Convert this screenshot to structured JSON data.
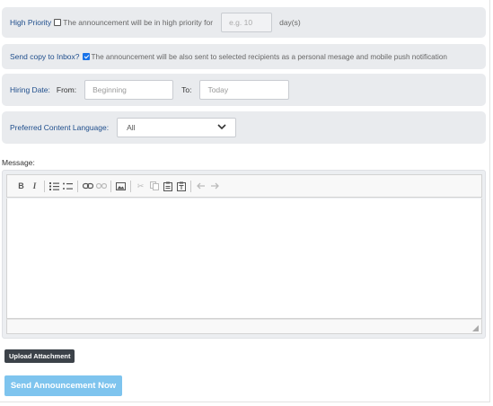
{
  "priority": {
    "label": "High Priority",
    "description": "The announcement will be in high priority for",
    "days_placeholder": "e.g. 10",
    "days_unit": "day(s)",
    "checked": false
  },
  "inbox": {
    "label": "Send copy to Inbox?",
    "description": "The announcement will be also sent to selected recipients as a personal mesage and mobile push notification",
    "checked": true
  },
  "hiring": {
    "label": "Hiring Date:",
    "from_label": "From:",
    "from_placeholder": "Beginning",
    "to_label": "To:",
    "to_placeholder": "Today"
  },
  "language": {
    "label": "Preferred Content Language:",
    "selected": "All"
  },
  "message": {
    "label": "Message:",
    "toolbar_icons": [
      "bold-icon",
      "italic-icon",
      "numbered-list-icon",
      "bulleted-list-icon",
      "link-icon",
      "unlink-icon",
      "image-icon",
      "cut-icon",
      "copy-icon",
      "paste-icon",
      "paste-text-icon",
      "undo-icon",
      "redo-icon"
    ]
  },
  "actions": {
    "upload_label": "Upload Attachment",
    "send_label": "Send Announcement Now"
  },
  "colors": {
    "row_background": "#e9ebee",
    "label_blue": "#1f4e8c",
    "checkbox_checked": "#1a73e8",
    "upload_button": "#3c4249",
    "send_button": "#7ec4ee"
  }
}
